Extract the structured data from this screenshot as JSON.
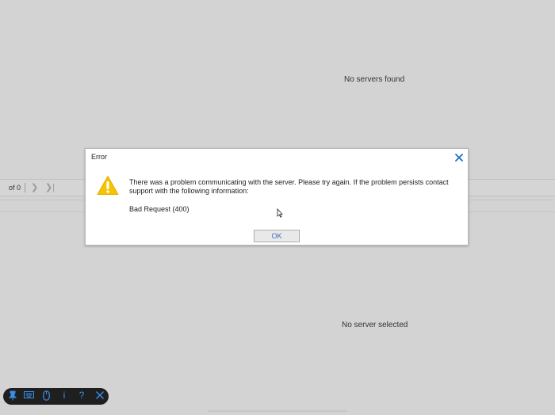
{
  "panels": {
    "servers_empty_text": "No servers found",
    "selection_empty_text": "No server selected"
  },
  "pager": {
    "of_text": "of 0"
  },
  "dialog": {
    "title": "Error",
    "message": "There was a problem communicating with the server. Please try again. If the problem persists contact support with the following information:",
    "detail": "Bad Request (400)",
    "ok_label": "OK",
    "icon": "warning-icon",
    "close_icon": "close-icon"
  },
  "toolbar": {
    "items": [
      {
        "icon": "pin-icon"
      },
      {
        "icon": "keyboard-icon"
      },
      {
        "icon": "mouse-icon"
      },
      {
        "icon": "info-icon",
        "glyph": "i"
      },
      {
        "icon": "help-icon",
        "glyph": "?"
      },
      {
        "icon": "close-icon"
      }
    ]
  },
  "colors": {
    "background": "#d3d3d3",
    "dialog_background": "#ffffff",
    "accent": "#1e6fc5",
    "warning": "#f5c400",
    "toolbar_bg": "#1f1f1f",
    "toolbar_icon": "#3b8ee8"
  }
}
